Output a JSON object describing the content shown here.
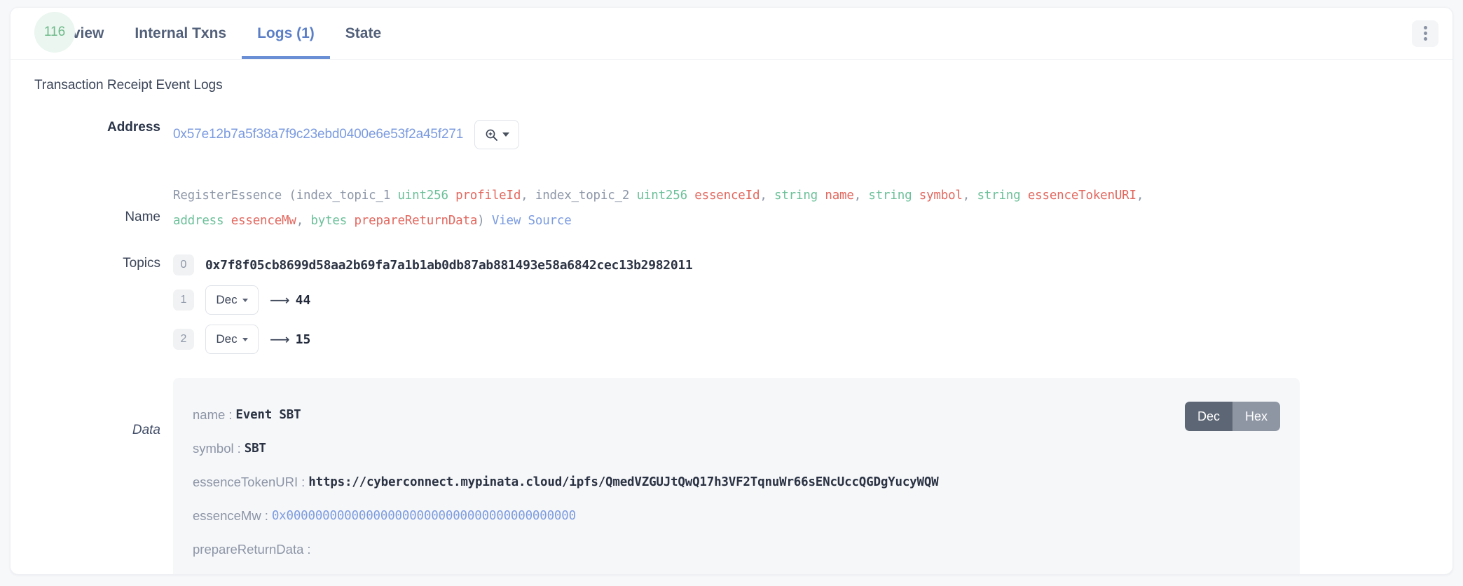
{
  "tabs": [
    {
      "label": "Overview",
      "active": false
    },
    {
      "label": "Internal Txns",
      "active": false
    },
    {
      "label": "Logs (1)",
      "active": true
    },
    {
      "label": "State",
      "active": false
    }
  ],
  "menu": {
    "kebab_name": "more-options"
  },
  "section": {
    "title": "Transaction Receipt Event Logs"
  },
  "log": {
    "index_badge": "116",
    "address": {
      "label": "Address",
      "value": "0x57e12b7a5f38a7f9c23ebd0400e6e53f2a45f271",
      "magnifier_name": "zoom-in-icon"
    },
    "name": {
      "label": "Name",
      "event": "RegisterEssence",
      "open_paren": " (",
      "params": [
        {
          "index_topic": "index_topic_1",
          "type": "uint256",
          "param": "profileId",
          "comma": ","
        },
        {
          "index_topic": "index_topic_2",
          "type": "uint256",
          "param": "essenceId",
          "comma": ","
        },
        {
          "index_topic": "",
          "type": "string",
          "param": "name",
          "comma": ","
        },
        {
          "index_topic": "",
          "type": "string",
          "param": "symbol",
          "comma": ","
        },
        {
          "index_topic": "",
          "type": "string",
          "param": "essenceTokenURI",
          "comma": ","
        },
        {
          "index_topic": "",
          "type": "address",
          "param": "essenceMw",
          "comma": ","
        },
        {
          "index_topic": "",
          "type": "bytes",
          "param": "prepareReturnData",
          "comma": ""
        }
      ],
      "close_paren": ")",
      "view_source": "View Source"
    },
    "topics": {
      "label": "Topics",
      "items": [
        {
          "index": "0",
          "kind": "hash",
          "value": "0x7f8f05cb8699d58aa2b69fa7a1b1ab0db87ab881493e58a6842cec13b2982011"
        },
        {
          "index": "1",
          "kind": "decoded",
          "format": "Dec",
          "arrow": "⟶",
          "value": "44"
        },
        {
          "index": "2",
          "kind": "decoded",
          "format": "Dec",
          "arrow": "⟶",
          "value": "15"
        }
      ]
    },
    "data": {
      "label": "Data",
      "toggle": {
        "dec": "Dec",
        "hex": "Hex",
        "selected": "Dec"
      },
      "fields": [
        {
          "key": "name",
          "sep": ":",
          "value": "Event SBT",
          "link": false
        },
        {
          "key": "symbol",
          "sep": ":",
          "value": "SBT",
          "link": false
        },
        {
          "key": "essenceTokenURI",
          "sep": ":",
          "value": "https://cyberconnect.mypinata.cloud/ipfs/QmedVZGUJtQwQ17h3VF2TqnuWr66sENcUccQGDgYucyWQW",
          "link": false
        },
        {
          "key": "essenceMw",
          "sep": ":",
          "value": "0x0000000000000000000000000000000000000000",
          "link": true
        },
        {
          "key": "prepareReturnData",
          "sep": ":",
          "value": "",
          "link": false
        }
      ]
    }
  },
  "colors": {
    "accent": "#6b8fd4",
    "link": "#7b9be0",
    "type": "#6cc09a",
    "param": "#e2685f",
    "badge_bg": "#eaf6ef",
    "badge_text": "#6fb98a",
    "panel_bg": "#f6f7f9"
  }
}
